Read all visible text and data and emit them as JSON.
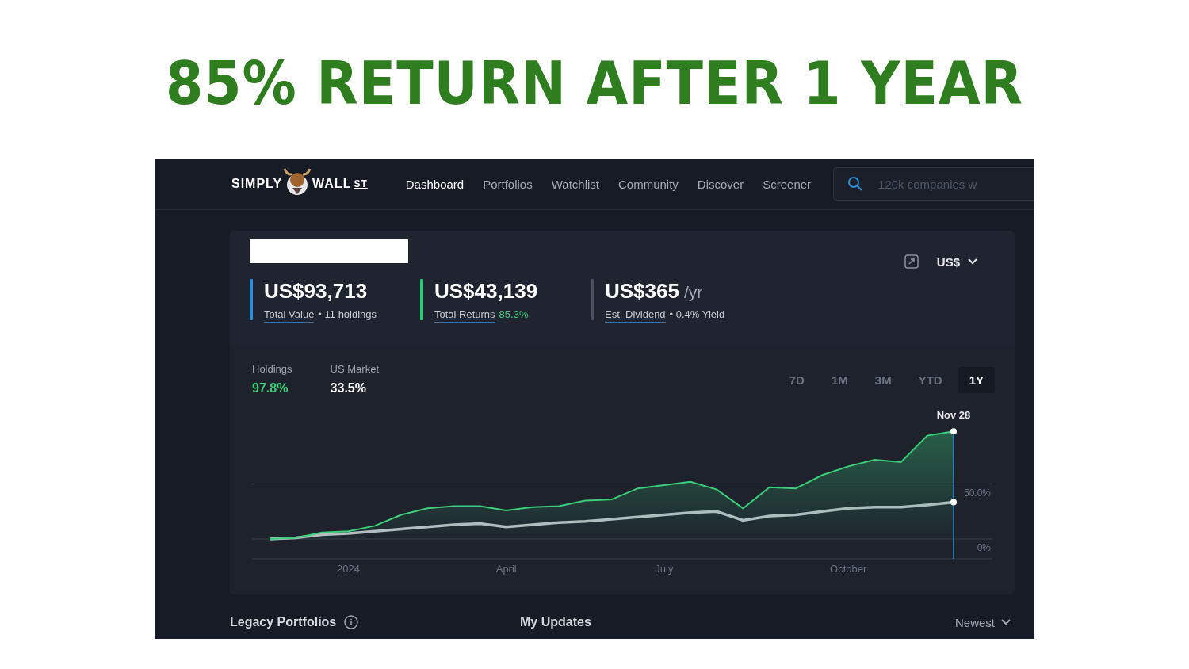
{
  "headline": "85% RETURN AFTER 1 YEAR",
  "logo": {
    "left": "SIMPLY",
    "right": "WALL",
    "suffix": "ST"
  },
  "nav": [
    {
      "label": "Dashboard",
      "selected": true
    },
    {
      "label": "Portfolios",
      "selected": false
    },
    {
      "label": "Watchlist",
      "selected": false
    },
    {
      "label": "Community",
      "selected": false
    },
    {
      "label": "Discover",
      "selected": false
    },
    {
      "label": "Screener",
      "selected": false
    }
  ],
  "search": {
    "placeholder": "120k companies w"
  },
  "currency": "US$",
  "stats": [
    {
      "value": "US$93,713",
      "label": "Total Value",
      "detail": "• 11 holdings",
      "positive": false,
      "color": "#2f8fd8"
    },
    {
      "value": "US$43,139",
      "label": "Total Returns",
      "detail": "85.3%",
      "positive": true,
      "color": "#2ecc71"
    },
    {
      "value": "US$365",
      "unit": "/yr",
      "label": "Est. Dividend",
      "detail": "• 0.4% Yield",
      "positive": false,
      "color": "#4a5161"
    }
  ],
  "comparison": [
    {
      "value": "97.8%",
      "color": "#3ccf7a"
    },
    {
      "value": "33.5%",
      "color": "#ffffff"
    }
  ],
  "periods": [
    {
      "label": "7D",
      "selected": false
    },
    {
      "label": "1M",
      "selected": false
    },
    {
      "label": "3M",
      "selected": false
    },
    {
      "label": "YTD",
      "selected": false
    },
    {
      "label": "1Y",
      "selected": true
    }
  ],
  "chart_data": {
    "type": "area",
    "categories": [
      null,
      null,
      null,
      "2024",
      null,
      null,
      null,
      null,
      null,
      "April",
      null,
      null,
      null,
      null,
      null,
      "July",
      null,
      null,
      null,
      null,
      null,
      null,
      "October",
      null,
      null,
      null,
      null
    ],
    "series": [
      {
        "name": "Holdings",
        "color": "#3ccf7a",
        "values": [
          0,
          1,
          6,
          7,
          12,
          22,
          28,
          30,
          30,
          26,
          29,
          30,
          35,
          36,
          46,
          49,
          52,
          45,
          28,
          47,
          46,
          58,
          66,
          72,
          70,
          94,
          97.8
        ]
      },
      {
        "name": "US Market",
        "type": "line",
        "color": "#b8bcc4",
        "values": [
          0,
          1,
          4,
          5,
          7,
          9,
          11,
          13,
          14,
          11,
          13,
          15,
          16,
          18,
          20,
          22,
          24,
          25,
          17,
          21,
          22,
          25,
          28,
          29,
          29,
          31,
          33.5
        ]
      }
    ],
    "ylim": [
      -18,
      98
    ],
    "yticks": [
      {
        "value": 0,
        "label": "0%"
      },
      {
        "value": 50,
        "label": "50.0%"
      }
    ],
    "annotations": [
      {
        "y": 97.8,
        "text": "Nov 28"
      }
    ]
  },
  "footer": {
    "left": "Legacy Portfolios",
    "center": "My Updates",
    "sort": "Newest"
  }
}
